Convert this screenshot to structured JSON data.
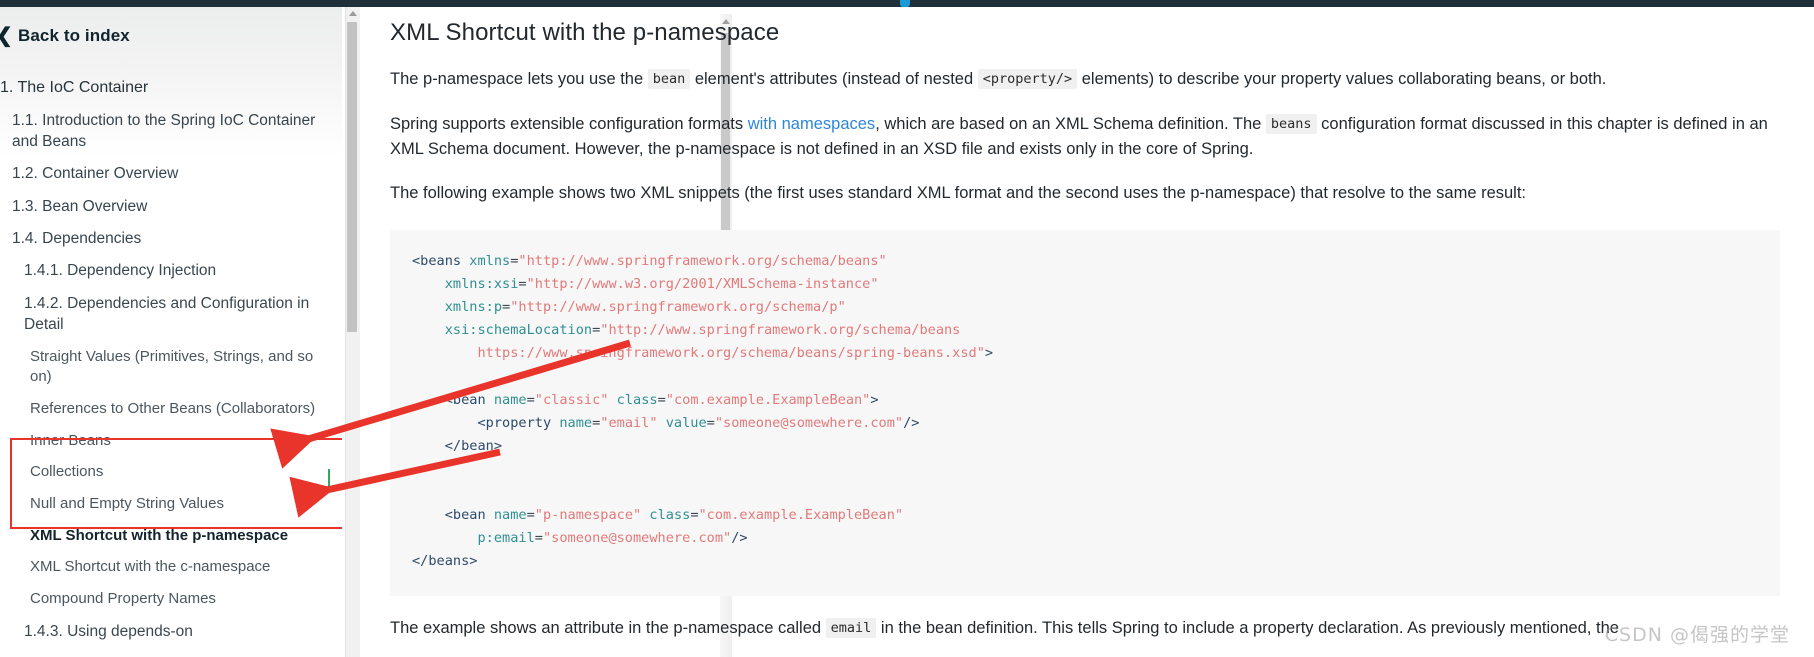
{
  "window": {
    "accent_color": "#1b9ad6",
    "chrome_color": "#20303a"
  },
  "sidebar": {
    "back_label": "Back to index",
    "back_icon": "chevron-left-icon",
    "items": [
      {
        "label": "1. The IoC Container",
        "level": 1,
        "active": false
      },
      {
        "label": "1.1. Introduction to the Spring IoC Container and Beans",
        "level": 2,
        "active": false
      },
      {
        "label": "1.2. Container Overview",
        "level": 2,
        "active": false
      },
      {
        "label": "1.3. Bean Overview",
        "level": 2,
        "active": false
      },
      {
        "label": "1.4. Dependencies",
        "level": 2,
        "active": false
      },
      {
        "label": "1.4.1. Dependency Injection",
        "level": 3,
        "active": false
      },
      {
        "label": "1.4.2. Dependencies and Configuration in Detail",
        "level": 3,
        "active": false
      },
      {
        "label": "Straight Values (Primitives, Strings, and so on)",
        "level": 4,
        "active": false
      },
      {
        "label": "References to Other Beans (Collaborators)",
        "level": 4,
        "active": false
      },
      {
        "label": "Inner Beans",
        "level": 4,
        "active": false
      },
      {
        "label": "Collections",
        "level": 4,
        "active": false
      },
      {
        "label": "Null and Empty String Values",
        "level": 4,
        "active": false
      },
      {
        "label": "XML Shortcut with the p-namespace",
        "level": 4,
        "active": true
      },
      {
        "label": "XML Shortcut with the c-namespace",
        "level": 4,
        "active": false
      },
      {
        "label": "Compound Property Names",
        "level": 4,
        "active": false
      },
      {
        "label": "1.4.3. Using depends-on",
        "level": 3,
        "active": false
      }
    ]
  },
  "annotations": {
    "box_color": "#e8342a",
    "arrow_color": "#e8342a",
    "tick_color": "#2faa5c"
  },
  "main": {
    "title": "XML Shortcut with the p-namespace",
    "paragraph1": {
      "part1": "The p-namespace lets you use the ",
      "code1": "bean",
      "part2": " element's attributes (instead of nested ",
      "code2": "<property/>",
      "part3": " elements) to describe your property values collaborating beans, or both."
    },
    "paragraph2": {
      "part1": "Spring supports extensible configuration formats ",
      "link": "with namespaces",
      "part2": ", which are based on an XML Schema definition. The ",
      "code1": "beans",
      "part3": " configuration format discussed in this chapter is defined in an XML Schema document. However, the p-namespace is not defined in an XSD file and exists only in the core of Spring."
    },
    "paragraph3": "The following example shows two XML snippets (the first uses standard XML format and the second uses the p-namespace) that resolve to the same result:",
    "code_lines": [
      [
        {
          "t": "tag",
          "v": "<beans "
        },
        {
          "t": "attr",
          "v": "xmlns"
        },
        {
          "t": "plain",
          "v": "="
        },
        {
          "t": "str",
          "v": "\"http://www.springframework.org/schema/beans\""
        }
      ],
      [
        {
          "t": "plain",
          "v": "    "
        },
        {
          "t": "attr",
          "v": "xmlns:xsi"
        },
        {
          "t": "plain",
          "v": "="
        },
        {
          "t": "str",
          "v": "\"http://www.w3.org/2001/XMLSchema-instance\""
        }
      ],
      [
        {
          "t": "plain",
          "v": "    "
        },
        {
          "t": "attr",
          "v": "xmlns:p"
        },
        {
          "t": "plain",
          "v": "="
        },
        {
          "t": "str",
          "v": "\"http://www.springframework.org/schema/p\""
        }
      ],
      [
        {
          "t": "plain",
          "v": "    "
        },
        {
          "t": "attr",
          "v": "xsi:schemaLocation"
        },
        {
          "t": "plain",
          "v": "="
        },
        {
          "t": "str",
          "v": "\"http://www.springframework.org/schema/beans"
        }
      ],
      [
        {
          "t": "plain",
          "v": "        "
        },
        {
          "t": "str",
          "v": "https://www.springframework.org/schema/beans/spring-beans.xsd\""
        },
        {
          "t": "tag",
          "v": ">"
        }
      ],
      [
        {
          "t": "blank",
          "v": ""
        }
      ],
      [
        {
          "t": "plain",
          "v": "    "
        },
        {
          "t": "tag",
          "v": "<bean "
        },
        {
          "t": "attr",
          "v": "name"
        },
        {
          "t": "plain",
          "v": "="
        },
        {
          "t": "str",
          "v": "\"classic\""
        },
        {
          "t": "plain",
          "v": " "
        },
        {
          "t": "attr",
          "v": "class"
        },
        {
          "t": "plain",
          "v": "="
        },
        {
          "t": "str",
          "v": "\"com.example.ExampleBean\""
        },
        {
          "t": "tag",
          "v": ">"
        }
      ],
      [
        {
          "t": "plain",
          "v": "        "
        },
        {
          "t": "tag",
          "v": "<property "
        },
        {
          "t": "attr",
          "v": "name"
        },
        {
          "t": "plain",
          "v": "="
        },
        {
          "t": "str",
          "v": "\"email\""
        },
        {
          "t": "plain",
          "v": " "
        },
        {
          "t": "attr",
          "v": "value"
        },
        {
          "t": "plain",
          "v": "="
        },
        {
          "t": "str",
          "v": "\"someone@somewhere.com\""
        },
        {
          "t": "tag",
          "v": "/>"
        }
      ],
      [
        {
          "t": "plain",
          "v": "    "
        },
        {
          "t": "tag",
          "v": "</bean>"
        }
      ],
      [
        {
          "t": "blank",
          "v": ""
        }
      ],
      [
        {
          "t": "blank",
          "v": ""
        }
      ],
      [
        {
          "t": "plain",
          "v": "    "
        },
        {
          "t": "tag",
          "v": "<bean "
        },
        {
          "t": "attr",
          "v": "name"
        },
        {
          "t": "plain",
          "v": "="
        },
        {
          "t": "str",
          "v": "\"p-namespace\""
        },
        {
          "t": "plain",
          "v": " "
        },
        {
          "t": "attr",
          "v": "class"
        },
        {
          "t": "plain",
          "v": "="
        },
        {
          "t": "str",
          "v": "\"com.example.ExampleBean\""
        }
      ],
      [
        {
          "t": "plain",
          "v": "        "
        },
        {
          "t": "attr",
          "v": "p:email"
        },
        {
          "t": "plain",
          "v": "="
        },
        {
          "t": "str",
          "v": "\"someone@somewhere.com\""
        },
        {
          "t": "tag",
          "v": "/>"
        }
      ],
      [
        {
          "t": "tag",
          "v": "</beans>"
        }
      ]
    ],
    "paragraph4": {
      "part1": "The example shows an attribute in the p-namespace called ",
      "code1": "email",
      "part2": " in the bean definition. This tells Spring to include a property declaration. As previously mentioned, the"
    }
  },
  "watermark": "CSDN @偈强的学堂"
}
